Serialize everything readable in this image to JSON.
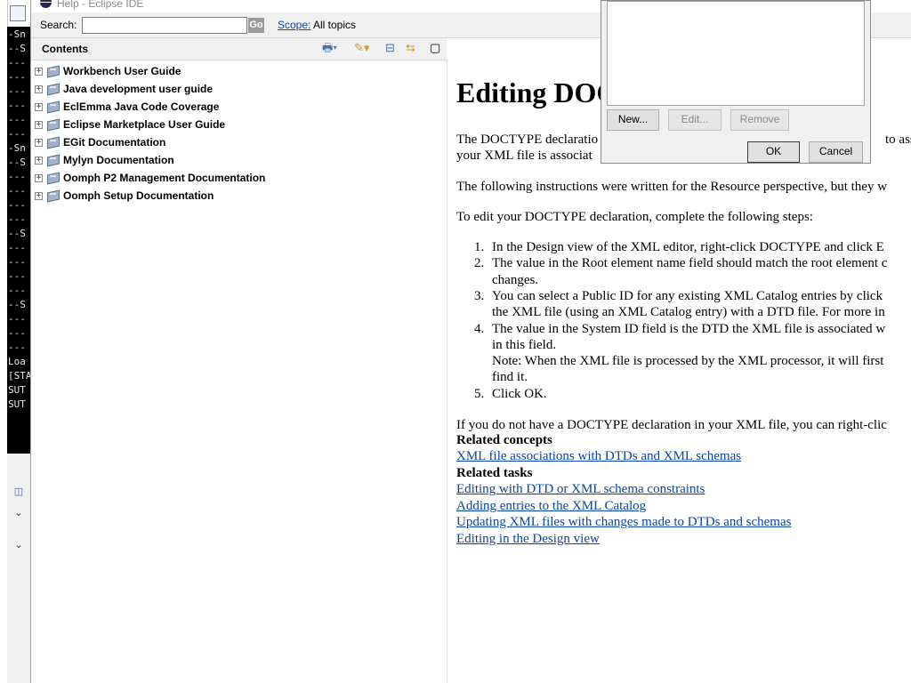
{
  "window": {
    "title": "Help - Eclipse IDE"
  },
  "background_console": {
    "lines": [
      "-Sn",
      "--S",
      "---",
      "---",
      "---",
      "---",
      "---",
      "---",
      "-Sn",
      "--S",
      "---",
      "---",
      "---",
      "---",
      "--S",
      "---",
      "---",
      "---",
      "---",
      "--S",
      "---",
      "---",
      "---",
      "Loa",
      "[STA",
      "SUT",
      "SUT"
    ]
  },
  "search": {
    "label": "Search:",
    "value": "",
    "go_label": "Go",
    "scope_link": "Scope:",
    "scope_value": "All topics"
  },
  "contents": {
    "title": "Contents",
    "toolbar_icons": [
      "print-icon",
      "link-with-contents-icon",
      "collapse-all-icon",
      "sync-toc-icon",
      "maximize-icon"
    ],
    "items": [
      {
        "label": "Workbench User Guide"
      },
      {
        "label": "Java development user guide"
      },
      {
        "label": "EclEmma Java Code Coverage"
      },
      {
        "label": "Eclipse Marketplace User Guide"
      },
      {
        "label": "EGit Documentation"
      },
      {
        "label": "Mylyn Documentation"
      },
      {
        "label": "Oomph P2 Management Documentation"
      },
      {
        "label": "Oomph Setup Documentation"
      }
    ]
  },
  "document": {
    "title": "Editing DOC",
    "intro_line1": "The DOCTYPE declaratio",
    "intro_line1_tail": "to asso",
    "intro_line2": "your XML file is associat",
    "para2": "The following instructions were written for the Resource perspective, but they w",
    "para3": "To edit your DOCTYPE declaration, complete the following steps:",
    "steps": [
      {
        "num": "1.",
        "lines": [
          "In the Design view of the XML editor, right-click DOCTYPE and click E"
        ]
      },
      {
        "num": "2.",
        "lines": [
          "The value in the Root element name field should match the root element c",
          "changes."
        ]
      },
      {
        "num": "3.",
        "lines": [
          "You can select a Public ID for any existing XML Catalog entries by click",
          "the XML file (using an XML Catalog entry) with a DTD file. For more in"
        ]
      },
      {
        "num": "4.",
        "lines": [
          "The value in the System ID field is the DTD the XML file is associated w",
          "in this field.",
          "Note: When the XML file is processed by the XML processor, it will first",
          "find it."
        ]
      },
      {
        "num": "5.",
        "lines": [
          "Click OK."
        ]
      }
    ],
    "para4": "If you do not have a DOCTYPE declaration in your XML file, you can right-clic",
    "related_concepts_heading": "Related concepts",
    "related_concepts": [
      "XML file associations with DTDs and XML schemas"
    ],
    "related_tasks_heading": "Related tasks",
    "related_tasks": [
      "Editing with DTD or XML schema constraints",
      "Adding entries to the XML Catalog",
      "Updating XML files with changes made to DTDs and schemas",
      "Editing in the Design view"
    ]
  },
  "dialog": {
    "new_label": "New...",
    "edit_label": "Edit...",
    "remove_label": "Remove",
    "ok_label": "OK",
    "cancel_label": "Cancel"
  }
}
